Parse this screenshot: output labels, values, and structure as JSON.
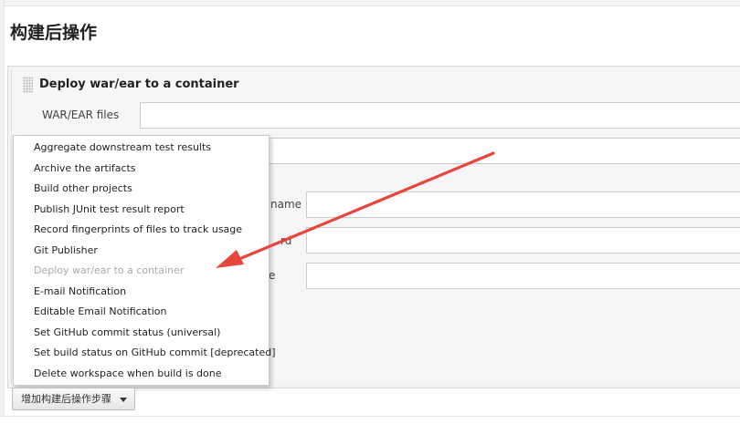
{
  "page": {
    "title": "构建后操作"
  },
  "section": {
    "title": "Deploy war/ear to a container",
    "war_ear_label": "WAR/EAR files",
    "partial_label_1": "name",
    "partial_label_2": "rd",
    "partial_label_3": "e"
  },
  "menu": {
    "items": [
      {
        "label": "Aggregate downstream test results"
      },
      {
        "label": "Archive the artifacts"
      },
      {
        "label": "Build other projects"
      },
      {
        "label": "Publish JUnit test result report"
      },
      {
        "label": "Record fingerprints of files to track usage"
      },
      {
        "label": "Git Publisher"
      },
      {
        "label": "Deploy war/ear to a container",
        "disabled": true
      },
      {
        "label": "E-mail Notification"
      },
      {
        "label": "Editable Email Notification"
      },
      {
        "label": "Set GitHub commit status (universal)"
      },
      {
        "label": "Set build status on GitHub commit [deprecated]"
      },
      {
        "label": "Delete workspace when build is done"
      }
    ]
  },
  "add_button": {
    "label": "增加构建后操作步骤"
  },
  "colors": {
    "annotation_arrow": "#e8453c",
    "disabled_text": "#a9a9a9"
  }
}
